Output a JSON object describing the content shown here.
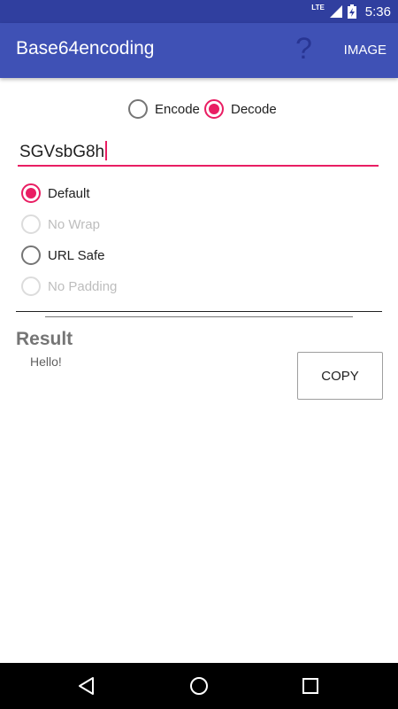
{
  "status_bar": {
    "time": "5:36",
    "network": "LTE"
  },
  "app_bar": {
    "title": "Base64encoding",
    "help_label": "?",
    "image_label": "IMAGE"
  },
  "mode": {
    "encode_label": "Encode",
    "decode_label": "Decode",
    "selected": "decode"
  },
  "input": {
    "value": "SGVsbG8h"
  },
  "options": [
    {
      "label": "Default",
      "checked": true,
      "enabled": true
    },
    {
      "label": "No Wrap",
      "checked": false,
      "enabled": false
    },
    {
      "label": "URL Safe",
      "checked": false,
      "enabled": true
    },
    {
      "label": "No Padding",
      "checked": false,
      "enabled": false
    }
  ],
  "result": {
    "heading": "Result",
    "value": "Hello!",
    "copy_label": "COPY"
  },
  "colors": {
    "primary": "#3F51B5",
    "primary_dark": "#303F9F",
    "accent": "#E91E63"
  },
  "icons": {
    "back": "back-triangle-icon",
    "home": "home-circle-icon",
    "recents": "recents-square-icon"
  }
}
